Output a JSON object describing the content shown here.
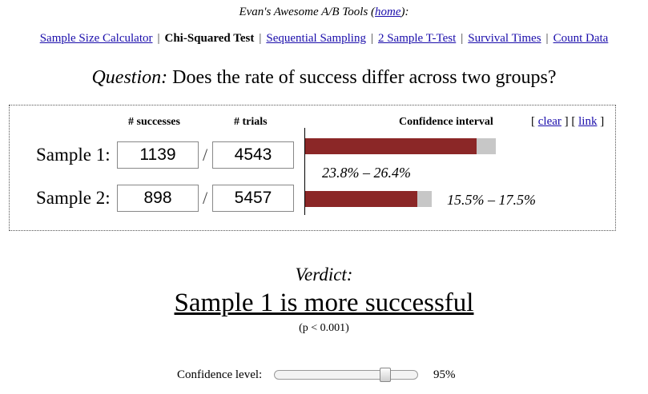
{
  "site": {
    "title_prefix": "Evan's Awesome A/B Tools (",
    "home_link": "home",
    "title_suffix": "):"
  },
  "nav": {
    "separator": "|",
    "items": [
      {
        "label": "Sample Size Calculator",
        "active": false
      },
      {
        "label": "Chi-Squared Test",
        "active": true
      },
      {
        "label": "Sequential Sampling",
        "active": false
      },
      {
        "label": "2 Sample T-Test",
        "active": false
      },
      {
        "label": "Survival Times",
        "active": false
      },
      {
        "label": "Count Data",
        "active": false
      }
    ]
  },
  "question": {
    "label": "Question:",
    "text": "Does the rate of success differ across two groups?"
  },
  "panel": {
    "headers": {
      "successes": "# successes",
      "trials": "# trials",
      "ci": "Confidence interval"
    },
    "links": {
      "open1": "[ ",
      "clear": "clear",
      "mid": " ] [ ",
      "link": "link",
      "close": " ]"
    },
    "slash": "/",
    "samples": [
      {
        "label": "Sample 1:",
        "successes": "1139",
        "trials": "4543",
        "ci_text": "23.8% – 26.4%",
        "ci_low": 0.238,
        "ci_high": 0.264
      },
      {
        "label": "Sample 2:",
        "successes": "898",
        "trials": "5457",
        "ci_text": "15.5% – 17.5%",
        "ci_low": 0.155,
        "ci_high": 0.175
      }
    ]
  },
  "verdict": {
    "label": "Verdict:",
    "text": "Sample 1 is more successful",
    "pvalue": "(p < 0.001)"
  },
  "confidence": {
    "label": "Confidence level:",
    "value_text": "95%",
    "slider_fraction": 0.8
  },
  "colors": {
    "bar_fill": "#8b2727",
    "bar_track": "#c7c7c7",
    "link": "#1a0dab"
  }
}
